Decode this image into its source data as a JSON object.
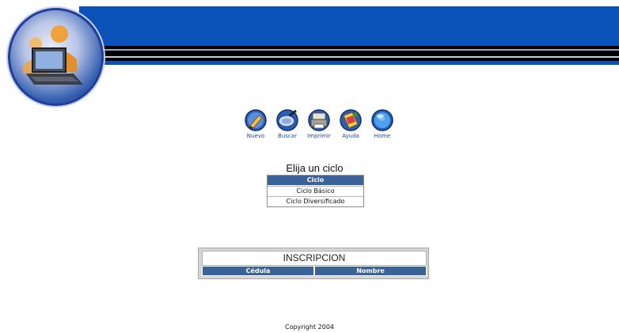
{
  "header": {
    "banner_color": "#0a52b8",
    "logo_icon": "computer-user-icon"
  },
  "toolbar": {
    "items": [
      {
        "label": "Nuevo",
        "icon": "pencil-icon"
      },
      {
        "label": "Buscar",
        "icon": "magnifier-icon"
      },
      {
        "label": "Imprimir",
        "icon": "printer-icon"
      },
      {
        "label": "Ayuda",
        "icon": "help-icon"
      },
      {
        "label": "Home",
        "icon": "globe-icon"
      }
    ]
  },
  "ciclo": {
    "title": "Elija un ciclo",
    "header": "Ciclo",
    "options": [
      "Ciclo Básico",
      "Ciclo Diversificado"
    ]
  },
  "inscripcion": {
    "title": "INSCRIPCION",
    "columns": [
      "Cédula",
      "Nombre"
    ]
  },
  "footer": {
    "copyright": "Copyright 2004"
  },
  "colors": {
    "table_header": "#3a6498",
    "link_text": "#1f4aa8"
  }
}
